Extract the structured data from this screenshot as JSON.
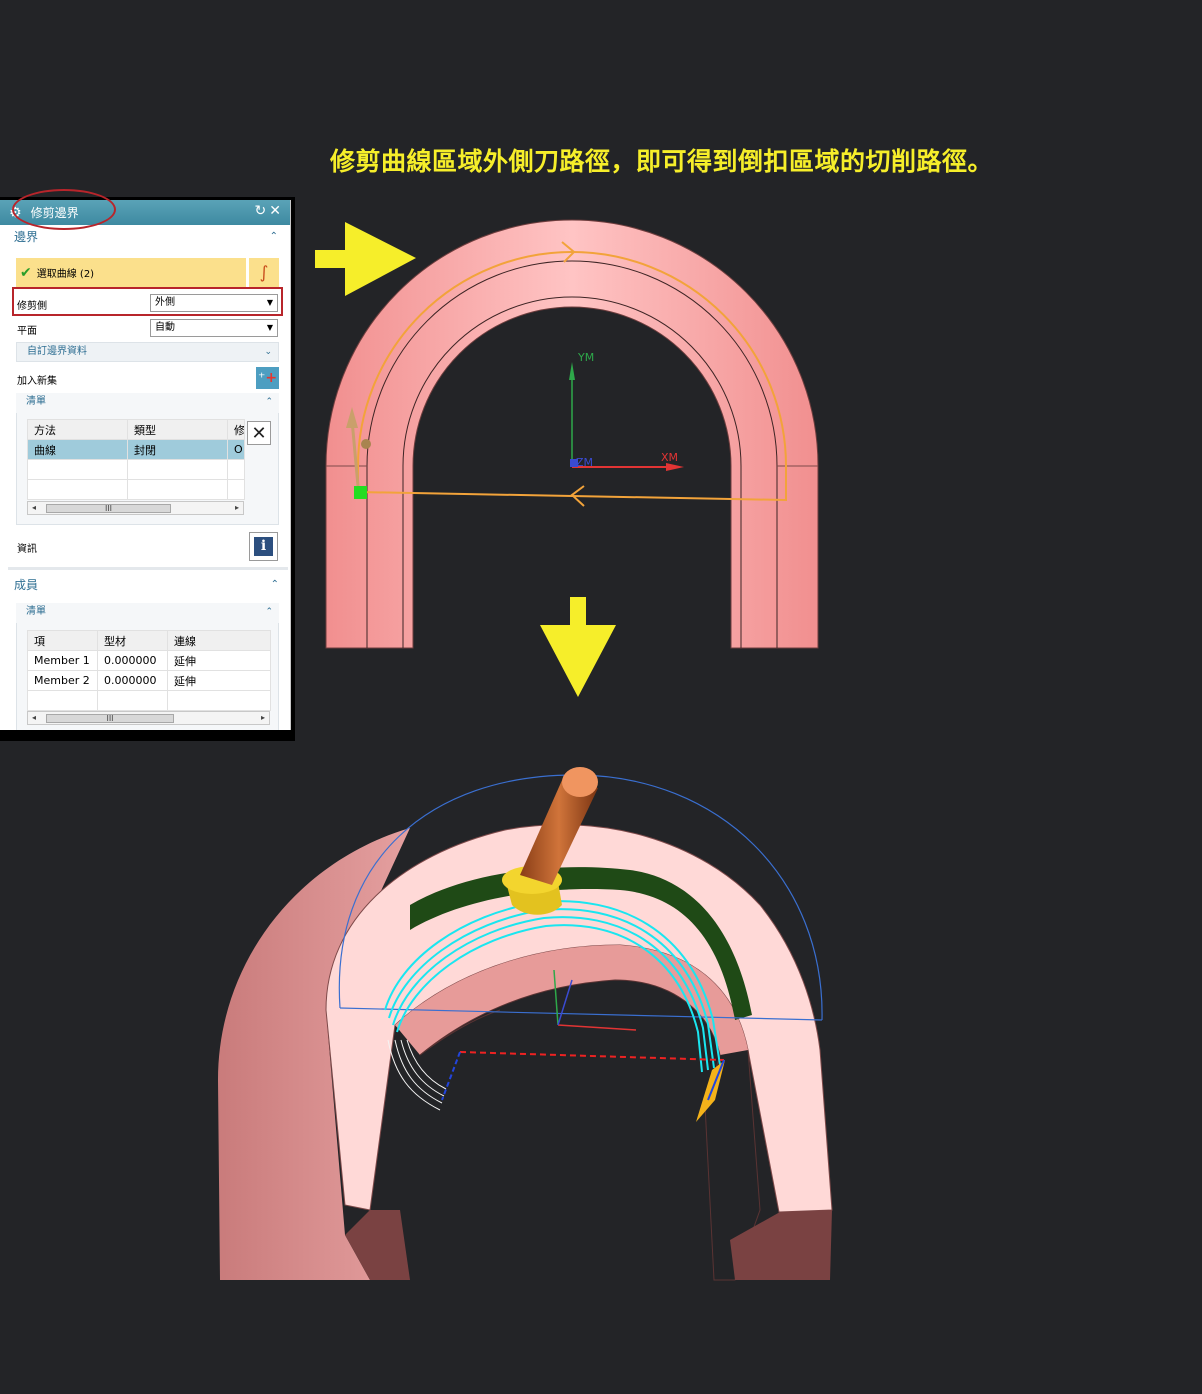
{
  "caption": "修剪曲線區域外側刀路徑，即可得到倒扣區域的切削路徑。",
  "dialog": {
    "title": "修剪邊界",
    "boundary_section": "邊界",
    "select_curve": "選取曲線 (2)",
    "trim_side_label": "修剪側",
    "trim_side_value": "外側",
    "plane_label": "平面",
    "plane_value": "自動",
    "custom_boundary": "自訂邊界資料",
    "add_new_set": "加入新集",
    "list_label": "清單",
    "list_columns": [
      "方法",
      "類型",
      "修"
    ],
    "list_rows": [
      [
        "曲線",
        "封閉",
        "O"
      ]
    ],
    "info_label": "資訊",
    "members_section": "成員",
    "members_list_label": "清單",
    "member_columns": [
      "項",
      "型材",
      "連線"
    ],
    "member_rows": [
      [
        "Member 1",
        "0.000000",
        "延伸"
      ],
      [
        "Member 2",
        "0.000000",
        "延伸"
      ]
    ],
    "scroll_thumb": "III"
  },
  "axes": {
    "ym": "YM",
    "xm": "XM",
    "zm": "ZM"
  },
  "colors": {
    "part": "#f7a3a3",
    "toolpath": "#f2a33a",
    "accent_yellow": "#f6ee2a",
    "titlebar": "#4896ad"
  }
}
